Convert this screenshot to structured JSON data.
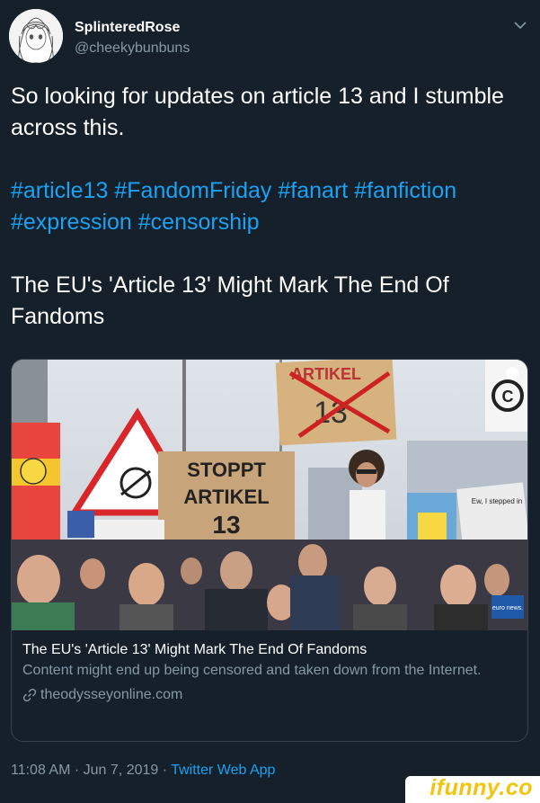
{
  "user": {
    "display_name": "SplinteredRose",
    "handle": "@cheekybunbuns"
  },
  "tweet": {
    "line1": "So looking for updates on article 13 and I stumble across this.",
    "hashtags_line1": [
      "#article13",
      "#FandomFriday",
      "#fanart",
      "#fanfiction"
    ],
    "hashtags_line2": [
      "#expression",
      "#censorship"
    ],
    "headline": "The EU's 'Article 13' Might Mark The End Of Fandoms"
  },
  "card": {
    "title": "The EU's 'Article 13' Might Mark The End Of Fandoms",
    "description": "Content might end up being censored and taken down from the Internet.",
    "domain": "theodysseyonline.com",
    "image_signs": {
      "main_sign": "STOPPT ARTIKEL 13",
      "top_sign": "ARTIKEL 13",
      "euronews": "euro news.",
      "note": "Ew, I stepped in"
    }
  },
  "meta": {
    "time": "11:08 AM",
    "separator": "·",
    "date": "Jun 7, 2019",
    "app": "Twitter Web App"
  },
  "watermark": {
    "text": "ifunny.co"
  },
  "colors": {
    "background": "#15202b",
    "link": "#1da1f2",
    "muted": "#8899a6",
    "border": "#38444d"
  }
}
